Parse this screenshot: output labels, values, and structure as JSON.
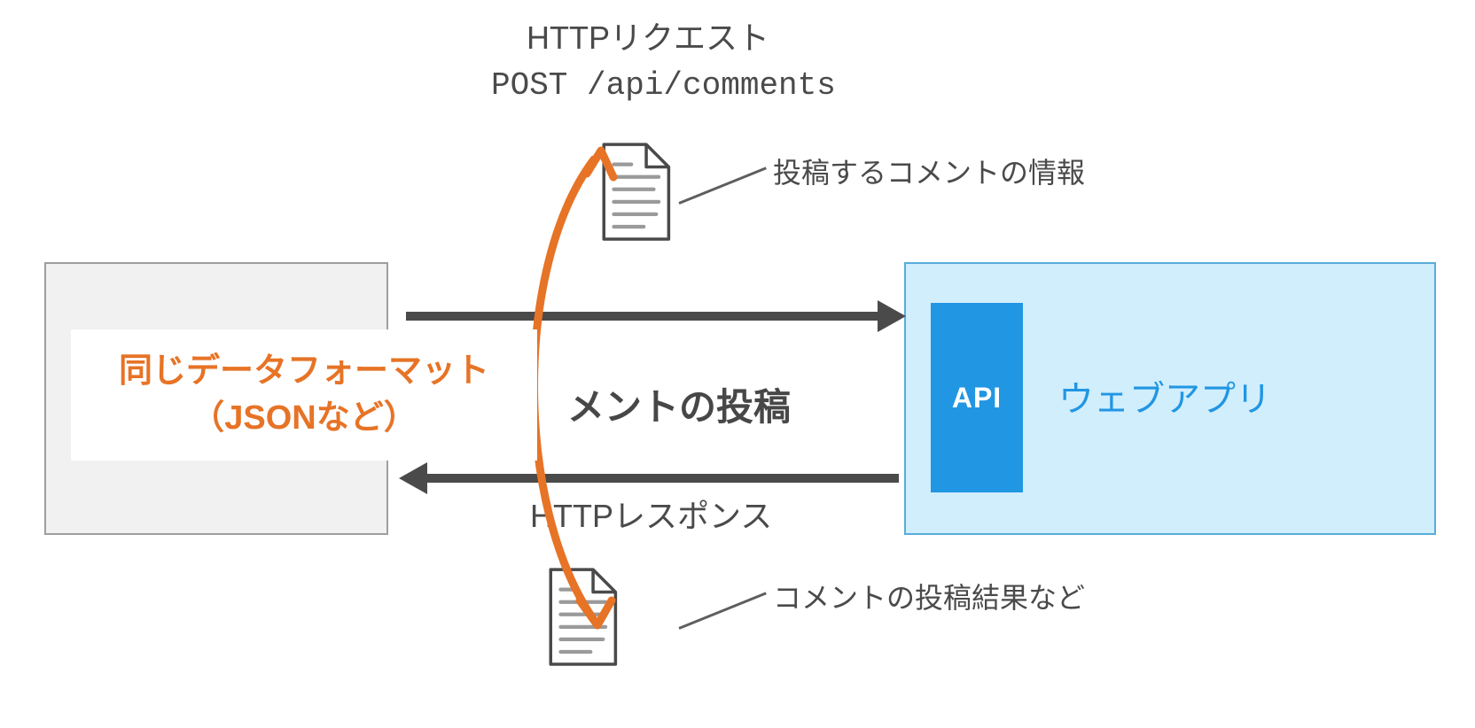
{
  "request": {
    "title": "HTTPリクエスト",
    "endpoint": "POST /api/comments",
    "payload_label": "投稿するコメントの情報"
  },
  "action": "メントの投稿",
  "response": {
    "title": "HTTPレスポンス",
    "result_label": "コメントの投稿結果など"
  },
  "callout": {
    "line1": "同じデータフォーマット",
    "line2": "（JSONなど）"
  },
  "webapp": {
    "api_badge": "API",
    "label": "ウェブアプリ"
  }
}
